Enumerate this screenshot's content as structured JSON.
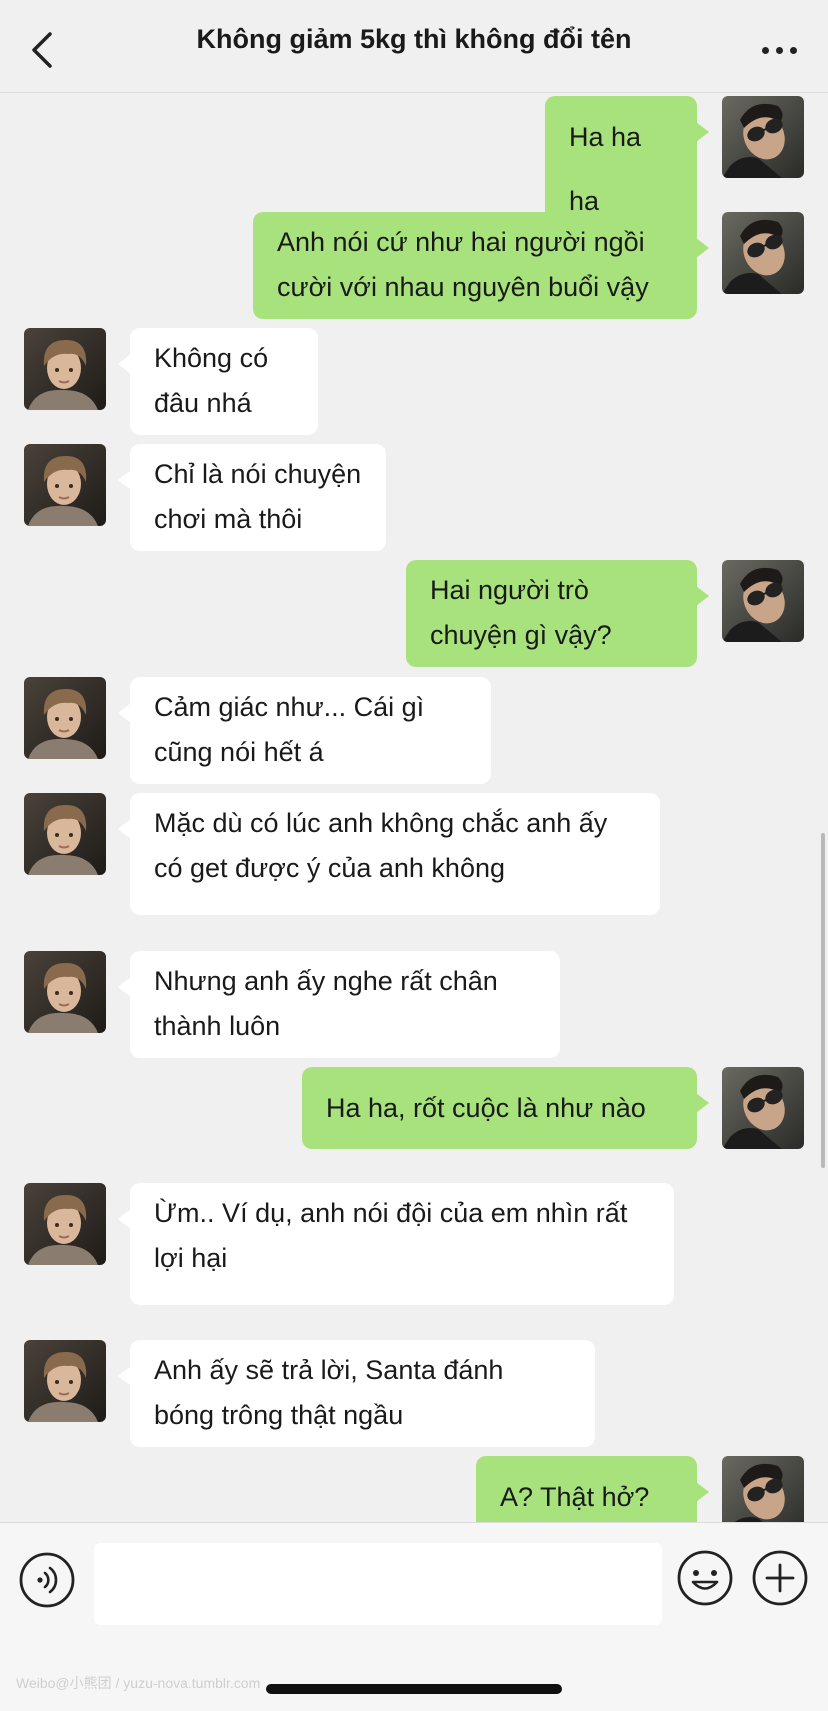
{
  "header": {
    "title": "Không giảm 5kg thì không đổi tên"
  },
  "colors": {
    "background": "#f0f0f0",
    "outgoing_bubble": "#a8e27c",
    "incoming_bubble": "#ffffff"
  },
  "messages": [
    {
      "sender": "me",
      "lines": [
        "Ha ha ha"
      ]
    },
    {
      "sender": "me",
      "lines": [
        "Anh nói cứ như hai người ngồi",
        "cười với nhau nguyên buổi vậy"
      ]
    },
    {
      "sender": "other",
      "lines": [
        "Không có",
        "đâu nhá"
      ]
    },
    {
      "sender": "other",
      "lines": [
        "Chỉ là nói chuyện",
        "chơi mà thôi"
      ]
    },
    {
      "sender": "me",
      "lines": [
        "Hai người trò",
        "chuyện gì vậy?"
      ]
    },
    {
      "sender": "other",
      "lines": [
        "Cảm giác như... Cái gì",
        "cũng nói hết á"
      ]
    },
    {
      "sender": "other",
      "lines": [
        "Mặc dù có lúc anh không chắc anh ấy",
        "có get được ý của anh không"
      ]
    },
    {
      "sender": "other",
      "lines": [
        "Nhưng anh ấy nghe rất chân",
        "thành luôn"
      ]
    },
    {
      "sender": "me",
      "lines": [
        "Ha ha, rốt cuộc là như nào"
      ]
    },
    {
      "sender": "other",
      "lines": [
        "Ừm.. Ví dụ, anh nói đội của em nhìn rất",
        "lợi hại"
      ]
    },
    {
      "sender": "other",
      "lines": [
        "Anh ấy sẽ trả lời, Santa đánh",
        "bóng trông thật ngầu"
      ]
    },
    {
      "sender": "me",
      "lines": [
        "A? Thật hở?"
      ]
    }
  ],
  "input": {
    "value": "",
    "icons": [
      "voice-icon",
      "emoji-icon",
      "plus-icon"
    ]
  },
  "watermark": "Weibo@小熊团 / yuzu-nova.tumblr.com"
}
